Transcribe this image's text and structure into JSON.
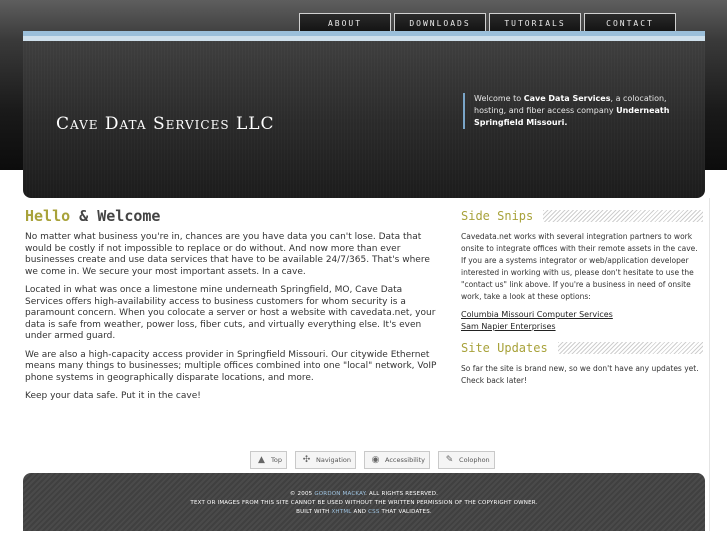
{
  "nav": {
    "items": [
      "ABOUT",
      "DOWNLOADS",
      "TUTORIALS",
      "CONTACT"
    ]
  },
  "header": {
    "site_title": "Cave Data Services LLC",
    "intro_prefix": "Welcome to ",
    "intro_bold1": "Cave Data Services",
    "intro_middle": ", a colocation, hosting, and fiber access company ",
    "intro_bold2": "Underneath Springfield Missouri."
  },
  "main": {
    "heading_accent": "Hello",
    "heading_rest": " & Welcome",
    "paragraphs": [
      "No matter what business you're in, chances are you have data you can't lose. Data that would be costly if not impossible to replace or do without. And now more than ever businesses create and use data services that have to be available 24/7/365. That's where we come in. We secure your most important assets. In a cave.",
      "Located in what was once a limestone mine underneath Springfield, MO, Cave Data Services offers high-availability access to business customers for whom security is a paramount concern. When you colocate a server or host a website with cavedata.net, your data is safe from weather, power loss, fiber cuts, and virtually everything else. It's even under armed guard.",
      "We are also a high-capacity access provider in Springfield Missouri. Our citywide Ethernet means many things to businesses; multiple offices combined into one \"local\" network, VoIP phone systems in geographically disparate locations, and more.",
      "Keep your data safe. Put it in the cave!"
    ]
  },
  "sidebar": {
    "snips_heading": "Side Snips",
    "snips_text": "Cavedata.net works with several integration partners to work onsite to integrate offices with their remote assets in the cave. If you are a systems integrator or web/application developer interested in working with us, please don't hesitate to use the \"contact us\" link above. If you're a business in need of onsite work, take a look at these options:",
    "links": [
      "Columbia Missouri Computer Services",
      "Sam Napier Enterprises"
    ],
    "updates_heading": "Site Updates",
    "updates_text": "So far the site is brand new, so we don't have any updates yet. Check back later!"
  },
  "bottom_links": [
    {
      "label": "Top",
      "icon": "arrow-up-icon"
    },
    {
      "label": "Navigation",
      "icon": "compass-icon"
    },
    {
      "label": "Accessibility",
      "icon": "eye-icon"
    },
    {
      "label": "Colophon",
      "icon": "speech-bubble-icon"
    }
  ],
  "footer": {
    "copyright_prefix": "© 2005 ",
    "copyright_name": "GORDON MACKAY",
    "copyright_suffix": ". ALL RIGHTS RESERVED.",
    "line2": "TEXT OR IMAGES FROM THIS SITE CANNOT BE USED WITHOUT THE WRITTEN PERMISSION OF THE COPYRIGHT OWNER.",
    "built_prefix": "BUILT WITH ",
    "built_xhtml": "XHTML",
    "built_and": " AND ",
    "built_css": "CSS",
    "built_suffix": " THAT VALIDATES."
  }
}
